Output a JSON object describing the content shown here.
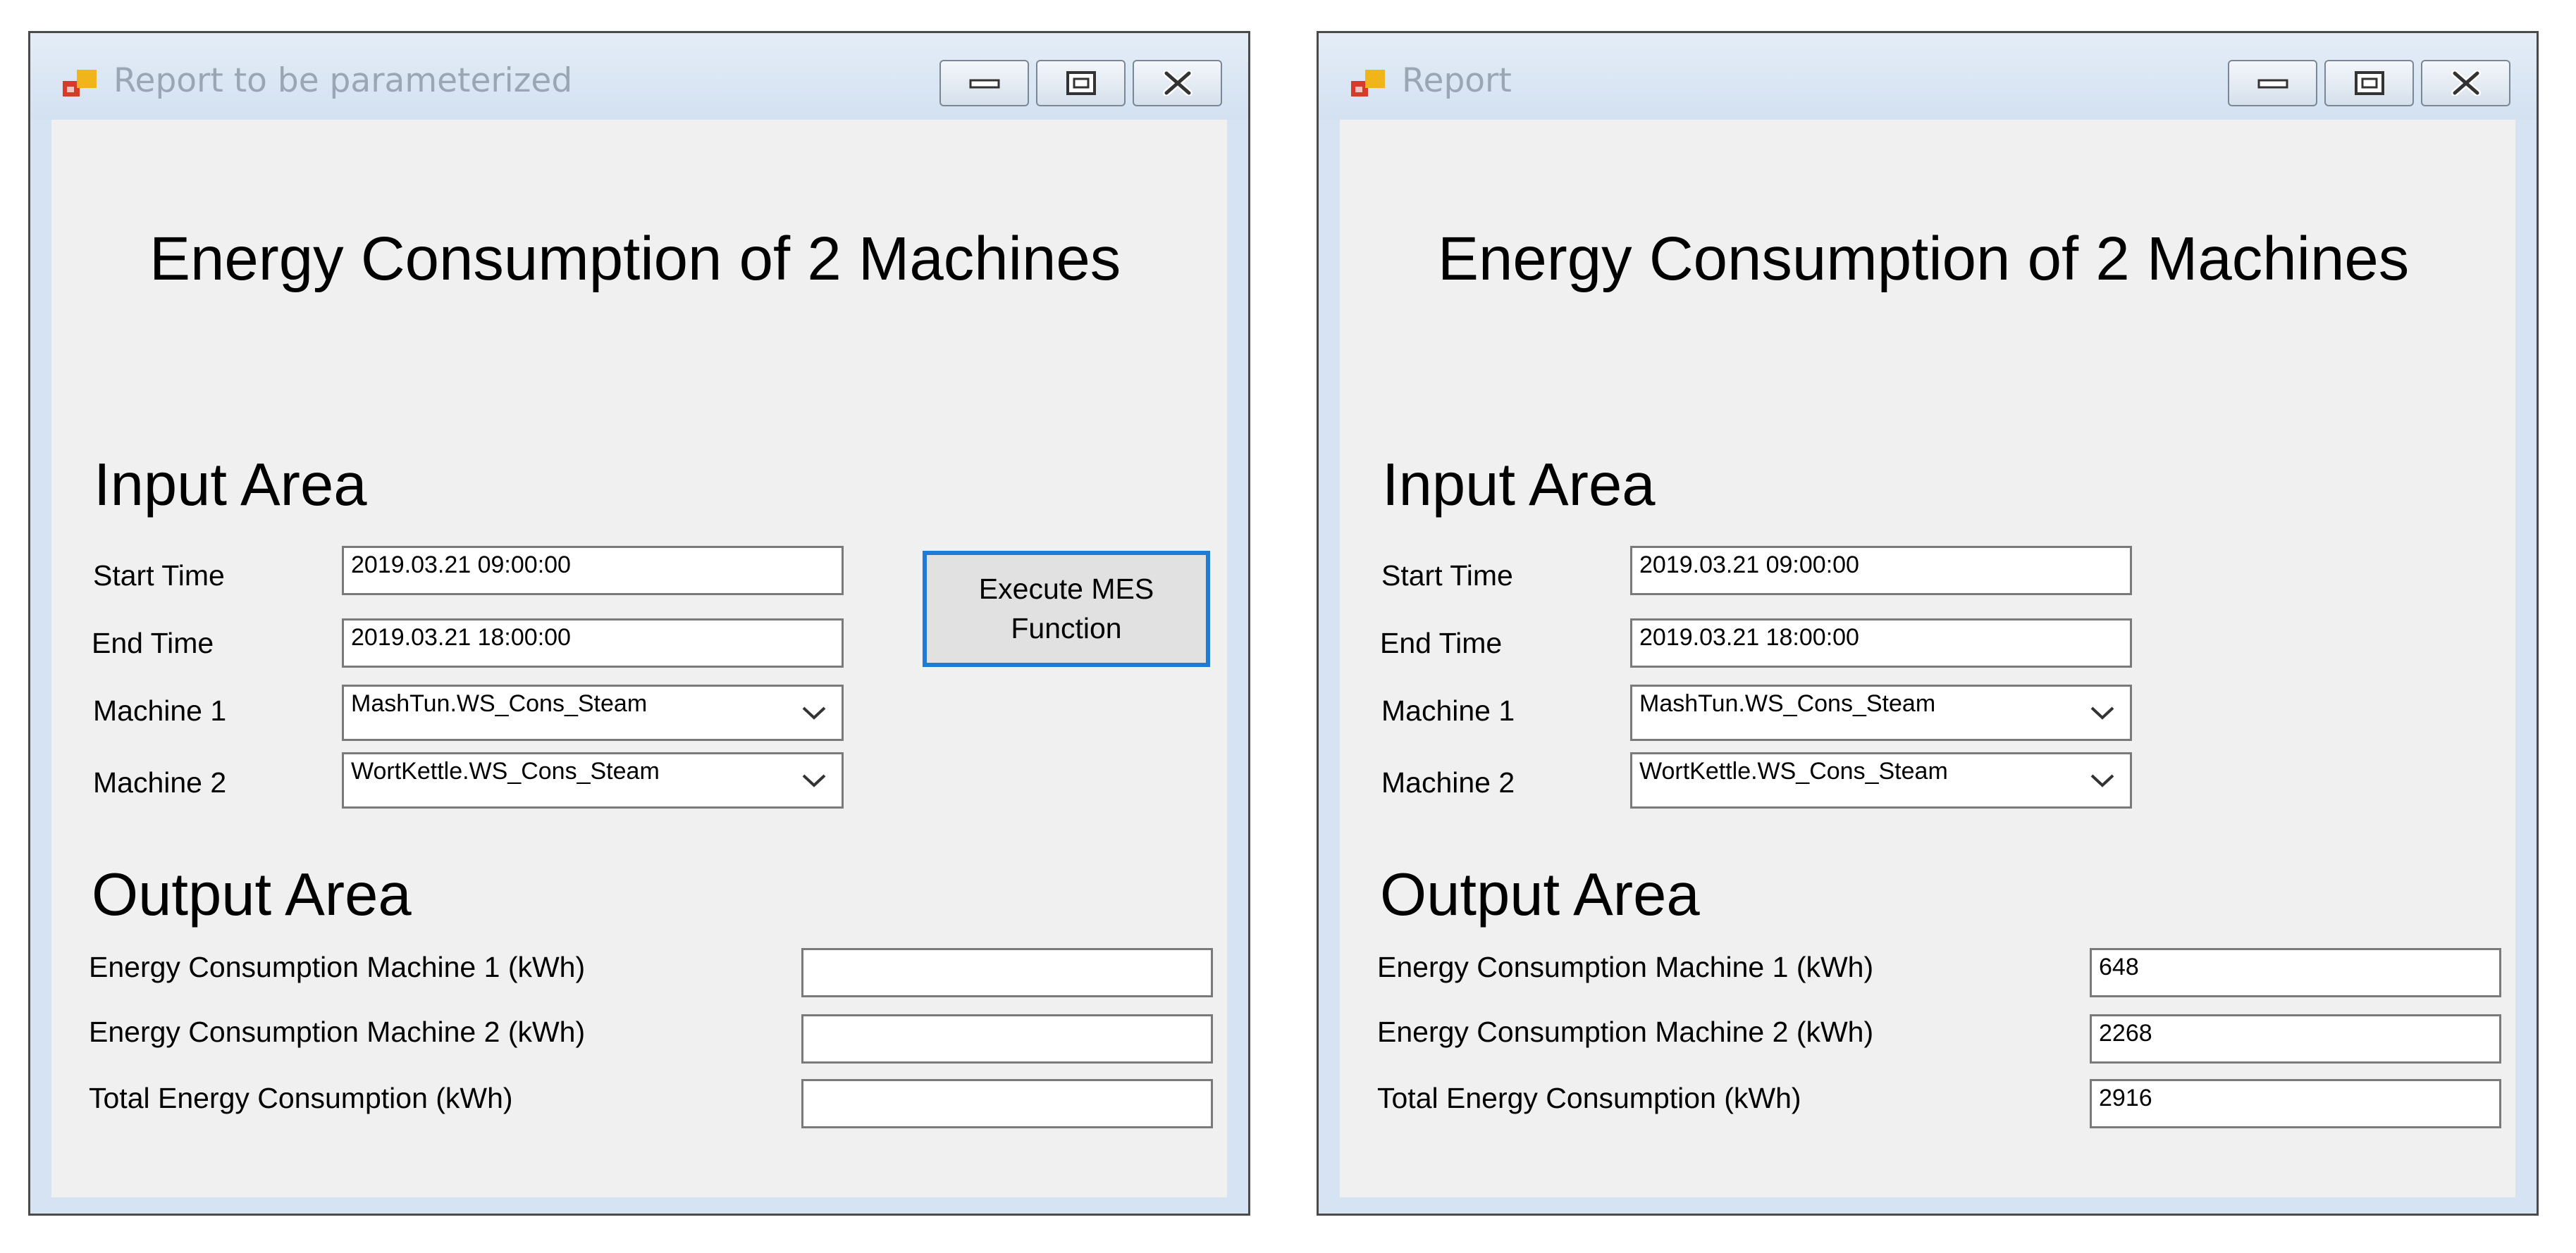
{
  "windows": [
    {
      "title": "Report to be parameterized",
      "report_title": "Energy Consumption of 2 Machines",
      "input_area": {
        "heading": "Input Area",
        "start_time": {
          "label": "Start Time",
          "value": "2019.03.21 09:00:00"
        },
        "end_time": {
          "label": "End Time",
          "value": "2019.03.21 18:00:00"
        },
        "machine1": {
          "label": "Machine 1",
          "value": "MashTun.WS_Cons_Steam"
        },
        "machine2": {
          "label": "Machine 2",
          "value": "WortKettle.WS_Cons_Steam"
        },
        "execute_button": {
          "line1": "Execute MES",
          "line2": "Function"
        }
      },
      "output_area": {
        "heading": "Output Area",
        "machine1": {
          "label": "Energy Consumption Machine 1 (kWh)",
          "value": ""
        },
        "machine2": {
          "label": "Energy Consumption Machine 2 (kWh)",
          "value": ""
        },
        "total": {
          "label": "Total Energy Consumption (kWh)",
          "value": ""
        }
      }
    },
    {
      "title": "Report",
      "report_title": "Energy Consumption of 2 Machines",
      "input_area": {
        "heading": "Input Area",
        "start_time": {
          "label": "Start Time",
          "value": "2019.03.21 09:00:00"
        },
        "end_time": {
          "label": "End Time",
          "value": "2019.03.21 18:00:00"
        },
        "machine1": {
          "label": "Machine 1",
          "value": "MashTun.WS_Cons_Steam"
        },
        "machine2": {
          "label": "Machine 2",
          "value": "WortKettle.WS_Cons_Steam"
        }
      },
      "output_area": {
        "heading": "Output Area",
        "machine1": {
          "label": "Energy Consumption Machine 1 (kWh)",
          "value": "648"
        },
        "machine2": {
          "label": "Energy Consumption Machine 2 (kWh)",
          "value": "2268"
        },
        "total": {
          "label": "Total Energy Consumption (kWh)",
          "value": "2916"
        }
      }
    }
  ],
  "icons": {
    "app": "app-window-icon",
    "minimize": "minimize-icon",
    "maximize": "maximize-icon",
    "close": "close-icon",
    "dropdown": "chevron-down-icon"
  },
  "colors": {
    "focus_border": "#1e7bd6",
    "title_text": "#9aa6b3",
    "client_bg": "#f0f0f0"
  }
}
